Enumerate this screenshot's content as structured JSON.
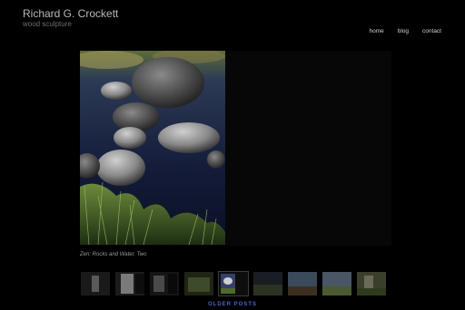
{
  "header": {
    "title": "Richard G. Crockett",
    "subtitle": "wood sculpture"
  },
  "nav": {
    "items": [
      {
        "label": "home"
      },
      {
        "label": "blog"
      },
      {
        "label": "contact"
      }
    ]
  },
  "main": {
    "caption": "Zen: Rocks and Water, Two"
  },
  "thumbnails": [
    {
      "icon": "sculpture-thumbnail",
      "selected": false
    },
    {
      "icon": "sculpture-thumbnail",
      "selected": false
    },
    {
      "icon": "sculpture-thumbnail",
      "selected": false
    },
    {
      "icon": "garden-thumbnail",
      "selected": false
    },
    {
      "icon": "rocks-water-thumbnail",
      "selected": true
    },
    {
      "icon": "landscape-thumbnail",
      "selected": false
    },
    {
      "icon": "landscape-thumbnail",
      "selected": false
    },
    {
      "icon": "landscape-thumbnail",
      "selected": false
    },
    {
      "icon": "landscape-thumbnail",
      "selected": false
    }
  ],
  "pagination": {
    "older_label": "OLDER POSTS"
  },
  "colors": {
    "background": "#000000",
    "link_accent": "#4a66c9"
  }
}
